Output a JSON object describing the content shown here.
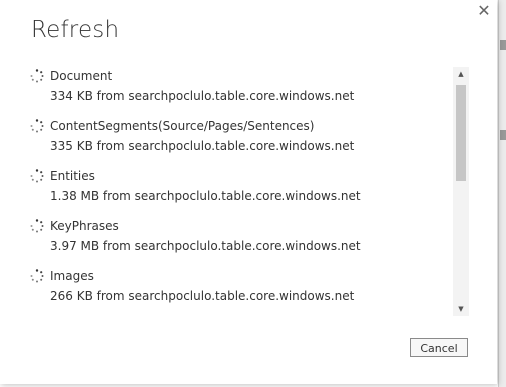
{
  "dialog": {
    "title": "Refresh",
    "close_icon": "close-icon",
    "cancel_label": "Cancel"
  },
  "items": [
    {
      "name": "Document",
      "detail": "334 KB from searchpoclulo.table.core.windows.net",
      "icon": "loading-spinner-icon"
    },
    {
      "name": "ContentSegments(Source/Pages/Sentences)",
      "detail": "335 KB from searchpoclulo.table.core.windows.net",
      "icon": "loading-spinner-icon"
    },
    {
      "name": "Entities",
      "detail": "1.38 MB from searchpoclulo.table.core.windows.net",
      "icon": "loading-spinner-icon"
    },
    {
      "name": "KeyPhrases",
      "detail": "3.97 MB from searchpoclulo.table.core.windows.net",
      "icon": "loading-spinner-icon"
    },
    {
      "name": "Images",
      "detail": "266 KB from searchpoclulo.table.core.windows.net",
      "icon": "loading-spinner-icon"
    }
  ],
  "scrollbar": {
    "up_icon": "scroll-up-arrow-icon",
    "down_icon": "scroll-down-arrow-icon"
  }
}
